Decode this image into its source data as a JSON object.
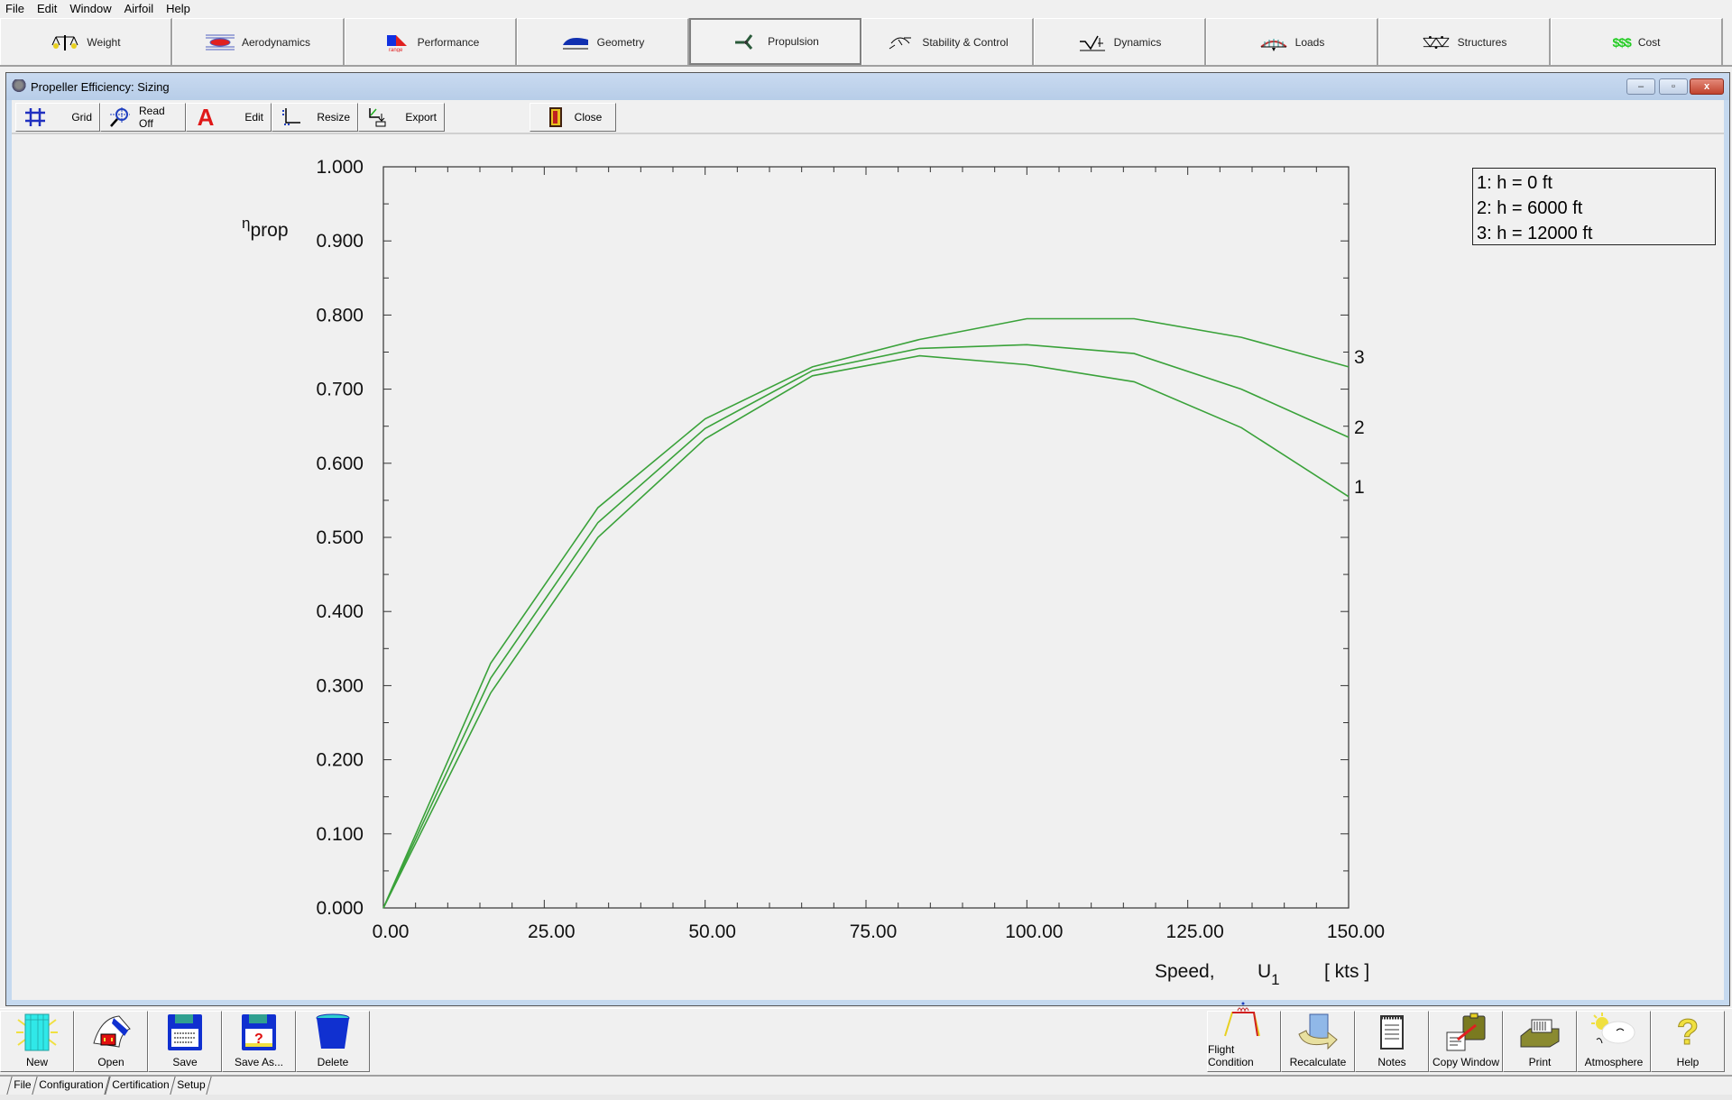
{
  "menu": [
    "File",
    "Edit",
    "Window",
    "Airfoil",
    "Help"
  ],
  "modules": [
    {
      "label": "Weight",
      "icon": "balance-scale-icon"
    },
    {
      "label": "Aerodynamics",
      "icon": "airflow-icon"
    },
    {
      "label": "Performance",
      "icon": "range-chart-icon"
    },
    {
      "label": "Geometry",
      "icon": "wing-geometry-icon"
    },
    {
      "label": "Propulsion",
      "icon": "propeller-icon",
      "active": true
    },
    {
      "label": "Stability & Control",
      "icon": "stability-icon"
    },
    {
      "label": "Dynamics",
      "icon": "dynamics-icon"
    },
    {
      "label": "Loads",
      "icon": "loads-icon"
    },
    {
      "label": "Structures",
      "icon": "truss-icon"
    },
    {
      "label": "Cost",
      "icon": "dollar-icon",
      "icon_text": "$$$"
    }
  ],
  "window": {
    "title": "Propeller Efficiency: Sizing",
    "controls": {
      "minimize": "–",
      "maximize": "▫",
      "close": "x"
    }
  },
  "toolbar": {
    "grid": "Grid",
    "readoff": "Read Off",
    "edit": "Edit",
    "resize": "Resize",
    "export": "Export",
    "close": "Close"
  },
  "legend": [
    "1: h = 0 ft",
    "2: h = 6000 ft",
    "3: h = 12000 ft"
  ],
  "colors": {
    "curve": "#3aa23a",
    "axis": "#333333",
    "cost_icon": "#22cc22"
  },
  "chart_data": {
    "type": "line",
    "title": "Propeller Efficiency: Sizing",
    "ylabel": "η",
    "ylabel_sub": "prop",
    "xlabel": "Speed,",
    "xlabel_symbol": "U",
    "xlabel_symbol_sub": "1",
    "xlabel_unit": "[ kts ]",
    "xlim": [
      0,
      150
    ],
    "ylim": [
      0,
      1
    ],
    "xticks": [
      0,
      25,
      50,
      75,
      100,
      125,
      150
    ],
    "xtick_labels": [
      "0.00",
      "25.00",
      "50.00",
      "75.00",
      "100.00",
      "125.00",
      "150.00"
    ],
    "yticks": [
      0,
      0.1,
      0.2,
      0.3,
      0.4,
      0.5,
      0.6,
      0.7,
      0.8,
      0.9,
      1.0
    ],
    "ytick_labels": [
      "0.000",
      "0.100",
      "0.200",
      "0.300",
      "0.400",
      "0.500",
      "0.600",
      "0.700",
      "0.800",
      "0.900",
      "1.000"
    ],
    "grid": false,
    "legend_position": "top-right",
    "x": [
      0,
      16.67,
      33.33,
      50,
      66.67,
      83.33,
      100,
      116.67,
      133.33,
      150
    ],
    "series": [
      {
        "name": "1: h = 0 ft",
        "end_label": "1",
        "values": [
          0,
          0.29,
          0.5,
          0.633,
          0.718,
          0.745,
          0.733,
          0.71,
          0.648,
          0.555
        ]
      },
      {
        "name": "2: h = 6000 ft",
        "end_label": "2",
        "values": [
          0,
          0.31,
          0.52,
          0.647,
          0.725,
          0.755,
          0.76,
          0.748,
          0.7,
          0.635
        ]
      },
      {
        "name": "3: h = 12000 ft",
        "end_label": "3",
        "values": [
          0,
          0.33,
          0.54,
          0.66,
          0.73,
          0.767,
          0.795,
          0.795,
          0.77,
          0.73
        ]
      }
    ]
  },
  "bottom_left_buttons": [
    "New",
    "Open",
    "Save",
    "Save As...",
    "Delete"
  ],
  "bottom_right_buttons": [
    "Flight Condition",
    "Recalculate",
    "Notes",
    "Copy Window",
    "Print",
    "Atmosphere",
    "Help"
  ],
  "bottom_tabs": [
    "File",
    "Configuration",
    "Certification",
    "Setup"
  ]
}
